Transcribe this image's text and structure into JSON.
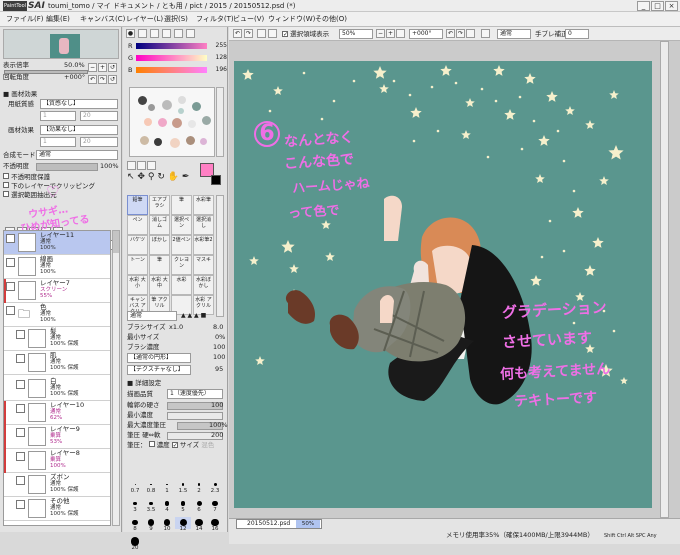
{
  "app": {
    "logo": "PaintTool",
    "logo_sai": "SAI",
    "title": "toumi_tomo / マイ ドキュメント / とも用 / pict / 2015 / 20150512.psd (*)",
    "win_min": "_",
    "win_max": "□",
    "win_close": "×"
  },
  "menu": [
    "ファイル(F)",
    "編集(E)",
    "キャンバス(C)",
    "レイヤー(L)",
    "選択(S)",
    "フィルタ(T)",
    "ビュー(V)",
    "ウィンドウ(W)",
    "その他(O)"
  ],
  "navigator": {
    "zoom_label": "表示倍率",
    "zoom_value": "50.0%",
    "angle_label": "回転角度",
    "angle_value": "+000°"
  },
  "paper_effect": {
    "heading": "画材効果",
    "texture_label": "用紙質感",
    "texture_value": "【質感なし】",
    "texture_num1": "1",
    "texture_num2": "20",
    "effect_label": "画材効果",
    "effect_value": "【効果なし】",
    "effect_num1": "1",
    "effect_num2": "20"
  },
  "layer_panel": {
    "blend_label": "合成モード",
    "blend_value": "通常",
    "opacity_label": "不透明度",
    "opacity_value": "100%",
    "protect_label": "不透明度保護",
    "clip_label": "下のレイヤーでクリッピング",
    "select_source_label": "選択範囲抽出元"
  },
  "layers": [
    {
      "name": "レイヤー11",
      "mode": "通常",
      "opacity": "100%",
      "selected": true,
      "red": false
    },
    {
      "name": "線画",
      "mode": "通常",
      "opacity": "100%",
      "selected": false,
      "red": false
    },
    {
      "name": "レイヤー7",
      "mode": "スクリーン",
      "opacity": "55%",
      "selected": false,
      "red": true
    },
    {
      "name": "色",
      "mode": "通常",
      "opacity": "100%",
      "selected": false,
      "red": false,
      "folder": true
    },
    {
      "name": "髪",
      "mode": "通常",
      "opacity": "100% 保護",
      "selected": false,
      "red": false
    },
    {
      "name": "肌",
      "mode": "通常",
      "opacity": "100% 保護",
      "selected": false,
      "red": false
    },
    {
      "name": "白",
      "mode": "通常",
      "opacity": "100% 保護",
      "selected": false,
      "red": false
    },
    {
      "name": "レイヤー10",
      "mode": "通常",
      "opacity": "62%",
      "selected": false,
      "red": true
    },
    {
      "name": "レイヤー9",
      "mode": "乗算",
      "opacity": "53%",
      "selected": false,
      "red": true
    },
    {
      "name": "レイヤー8",
      "mode": "乗算",
      "opacity": "100%",
      "selected": false,
      "red": true
    },
    {
      "name": "ズボン",
      "mode": "通常",
      "opacity": "100% 保護",
      "selected": false,
      "red": false
    },
    {
      "name": "その他",
      "mode": "通常",
      "opacity": "100% 保護",
      "selected": false,
      "red": false
    }
  ],
  "color": {
    "r_label": "R",
    "r_value": "255",
    "g_label": "G",
    "g_value": "128",
    "b_label": "B",
    "b_value": "196",
    "main_color": "#ff80c4"
  },
  "tools": [
    "鉛筆",
    "エアブラシ",
    "筆",
    "水彩筆",
    "ペン",
    "消しゴム",
    "選択ペン",
    "選択消し",
    "バケツ",
    "ぼかし",
    "2値ペン",
    "水彩筆2",
    "トーン",
    "筆",
    "クレヨン",
    "マスキ",
    "水彩 大小",
    "水彩 大中",
    "水彩",
    "水彩ぼかし",
    "キャンバス アクリル",
    "筆 アクリル",
    "",
    "水彩 アクリル"
  ],
  "brush": {
    "mode": "通常",
    "size_label": "ブラシサイズ",
    "size_mult": "x1.0",
    "size_value": "8.0",
    "min_size_label": "最小サイズ",
    "min_size_value": "0%",
    "density_label": "ブラシ濃度",
    "density_value": "100",
    "shape": "【通常の円形】",
    "shape_value": "100",
    "texture": "【テクスチャなし】",
    "texture_value": "95",
    "detail_heading": "詳細設定",
    "quality_label": "描画品質",
    "quality_value": "1（速度優先）",
    "hardness_label": "輪郭の硬さ",
    "hardness_value": "100",
    "min_density_label": "最小濃度",
    "max_pressure_label": "最大濃度筆圧",
    "max_pressure_value": "100%",
    "pressure_label": "筆圧 硬⇔軟",
    "pressure_value": "200",
    "pressure_line": "筆圧：",
    "density_check": "濃度",
    "size_check": "サイズ",
    "blend_check": "混色"
  },
  "brush_sizes": [
    "0.7",
    "0.8",
    "1",
    "1.5",
    "2",
    "2.3",
    "3",
    "3.5",
    "4",
    "5",
    "6",
    "7",
    "8",
    "9",
    "10",
    "12",
    "14",
    "16",
    "20"
  ],
  "canvas_toolbar": {
    "sel_label": "選択領域表示",
    "zoom": "50%",
    "angle": "+000°",
    "blend": "通常",
    "stabilizer_label": "手ブレ補正",
    "stabilizer_value": "0"
  },
  "canvas_text": {
    "circle_num": "6",
    "line1": "なんとなく",
    "line2": "こんな色で",
    "line3": "ハームじゃね",
    "line4": "って色で",
    "right1": "グラデーション",
    "right2": "させています",
    "right3": "何も考えてません",
    "right4": "テキトーです",
    "left_line1": "ウサギ…",
    "left_line2": "ひめが知ってる"
  },
  "status": {
    "doc_tab": "20150512.psd",
    "doc_zoom": "50%",
    "memory": "メモリ使用率35%（確保1400MB/上限3944MB）",
    "keys": "Shift Ctrl Alt SPC Any"
  }
}
